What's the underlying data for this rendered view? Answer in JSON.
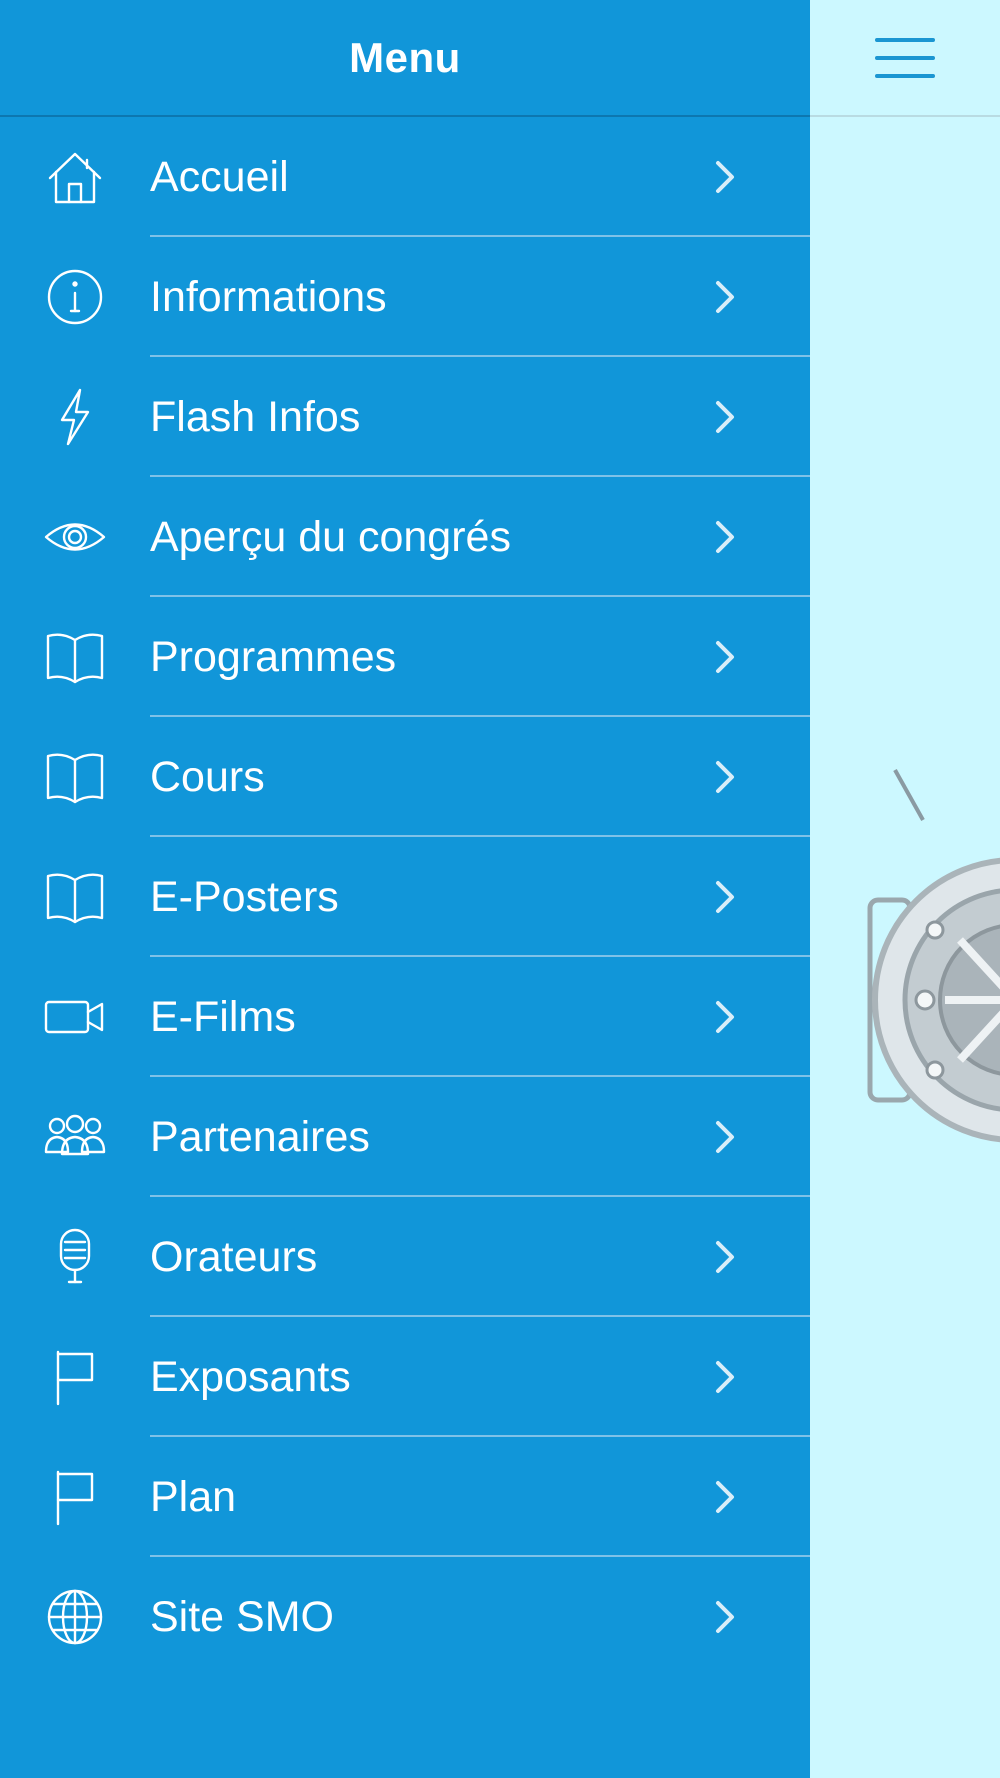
{
  "drawer": {
    "title": "Menu",
    "items": [
      {
        "label": "Accueil",
        "icon": "home-icon"
      },
      {
        "label": "Informations",
        "icon": "info-icon"
      },
      {
        "label": "Flash Infos",
        "icon": "lightning-icon"
      },
      {
        "label": "Aperçu du congrés",
        "icon": "eye-icon"
      },
      {
        "label": "Programmes",
        "icon": "book-icon"
      },
      {
        "label": "Cours",
        "icon": "book-icon"
      },
      {
        "label": "E-Posters",
        "icon": "book-icon"
      },
      {
        "label": "E-Films",
        "icon": "video-camera-icon"
      },
      {
        "label": "Partenaires",
        "icon": "people-icon"
      },
      {
        "label": "Orateurs",
        "icon": "microphone-icon"
      },
      {
        "label": "Exposants",
        "icon": "flag-icon"
      },
      {
        "label": "Plan",
        "icon": "flag-icon"
      },
      {
        "label": "Site SMO",
        "icon": "globe-icon"
      }
    ]
  },
  "topbar": {
    "menu_icon": "hamburger-icon"
  },
  "colors": {
    "drawer_background": "#1196d9",
    "content_background": "#ccf8ff",
    "hamburger": "#1a96d2",
    "divider": "#7fc2e8"
  }
}
